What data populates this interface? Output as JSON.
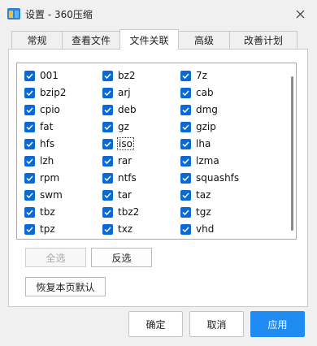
{
  "window": {
    "title": "设置 - 360压缩",
    "close_symbol": "✕"
  },
  "tabs": [
    {
      "label": "常规",
      "active": false
    },
    {
      "label": "查看文件",
      "active": false
    },
    {
      "label": "文件关联",
      "active": true
    },
    {
      "label": "高级",
      "active": false
    },
    {
      "label": "改善计划",
      "active": false
    }
  ],
  "file_types": {
    "col1": [
      "001",
      "bzip2",
      "cpio",
      "fat",
      "hfs",
      "lzh",
      "rpm",
      "swm",
      "tbz",
      "tpz"
    ],
    "col2": [
      "bz2",
      "arj",
      "deb",
      "gz",
      "iso",
      "rar",
      "ntfs",
      "tar",
      "tbz2",
      "txz"
    ],
    "col3": [
      "7z",
      "cab",
      "dmg",
      "gzip",
      "lha",
      "lzma",
      "squashfs",
      "taz",
      "tgz",
      "vhd"
    ],
    "all_checked": true,
    "focused": "iso"
  },
  "panel_buttons": {
    "select_all": "全选",
    "invert": "反选",
    "restore_default": "恢复本页默认"
  },
  "footer": {
    "ok": "确定",
    "cancel": "取消",
    "apply": "应用"
  },
  "colors": {
    "accent": "#1e8cf2",
    "checkbox": "#0b69d6"
  }
}
